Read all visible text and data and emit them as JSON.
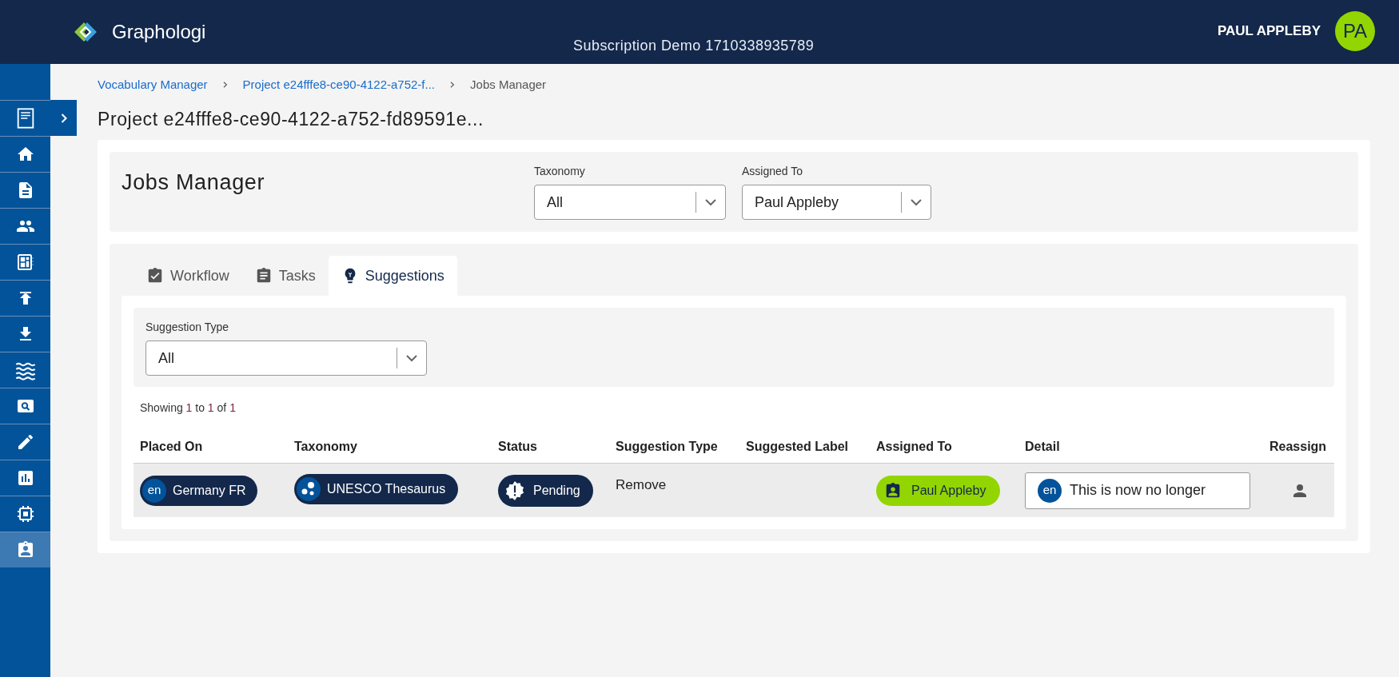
{
  "header": {
    "brand": "Graphologi",
    "subscription": "Subscription Demo 1710338935789",
    "user_name": "PAUL APPLEBY",
    "avatar": "PA"
  },
  "sidebar": {
    "items": [
      {
        "selected": false
      },
      {
        "selected": false
      },
      {
        "selected": false
      },
      {
        "selected": false
      },
      {
        "selected": false
      },
      {
        "selected": false
      },
      {
        "selected": false
      },
      {
        "selected": false
      },
      {
        "selected": false
      },
      {
        "selected": false
      },
      {
        "selected": false
      },
      {
        "selected": false
      },
      {
        "selected": true
      }
    ]
  },
  "breadcrumbs": [
    {
      "label": "Vocabulary Manager",
      "link": true
    },
    {
      "label": "Project e24fffe8-ce90-4122-a752-f...",
      "link": true
    },
    {
      "label": "Jobs Manager",
      "link": false
    }
  ],
  "page_title": "Project e24fffe8-ce90-4122-a752-fd89591e...",
  "jobs": {
    "title": "Jobs Manager",
    "filters": [
      {
        "label": "Taxonomy",
        "value": "All"
      },
      {
        "label": "Assigned To",
        "value": "Paul Appleby"
      }
    ]
  },
  "tabs": [
    {
      "label": "Workflow",
      "selected": false
    },
    {
      "label": "Tasks",
      "selected": false
    },
    {
      "label": "Suggestions",
      "selected": true
    }
  ],
  "suggestion_filter": {
    "label": "Suggestion Type",
    "value": "All"
  },
  "showing": [
    "Showing ",
    "1",
    " to ",
    "1",
    " of ",
    "1"
  ],
  "table": {
    "columns": [
      "Placed On",
      "Taxonomy",
      "Status",
      "Suggestion Type",
      "Suggested Label",
      "Assigned To",
      "Detail",
      "Reassign"
    ],
    "rows": [
      {
        "placed_on": {
          "lang": "en",
          "label": "Germany FR"
        },
        "taxonomy": "UNESCO Thesaurus",
        "status": "Pending",
        "suggestion_type": "Remove",
        "assigned_to": "Paul Appleby",
        "detail": {
          "lang": "en",
          "text": "This is now no longer"
        }
      }
    ]
  }
}
